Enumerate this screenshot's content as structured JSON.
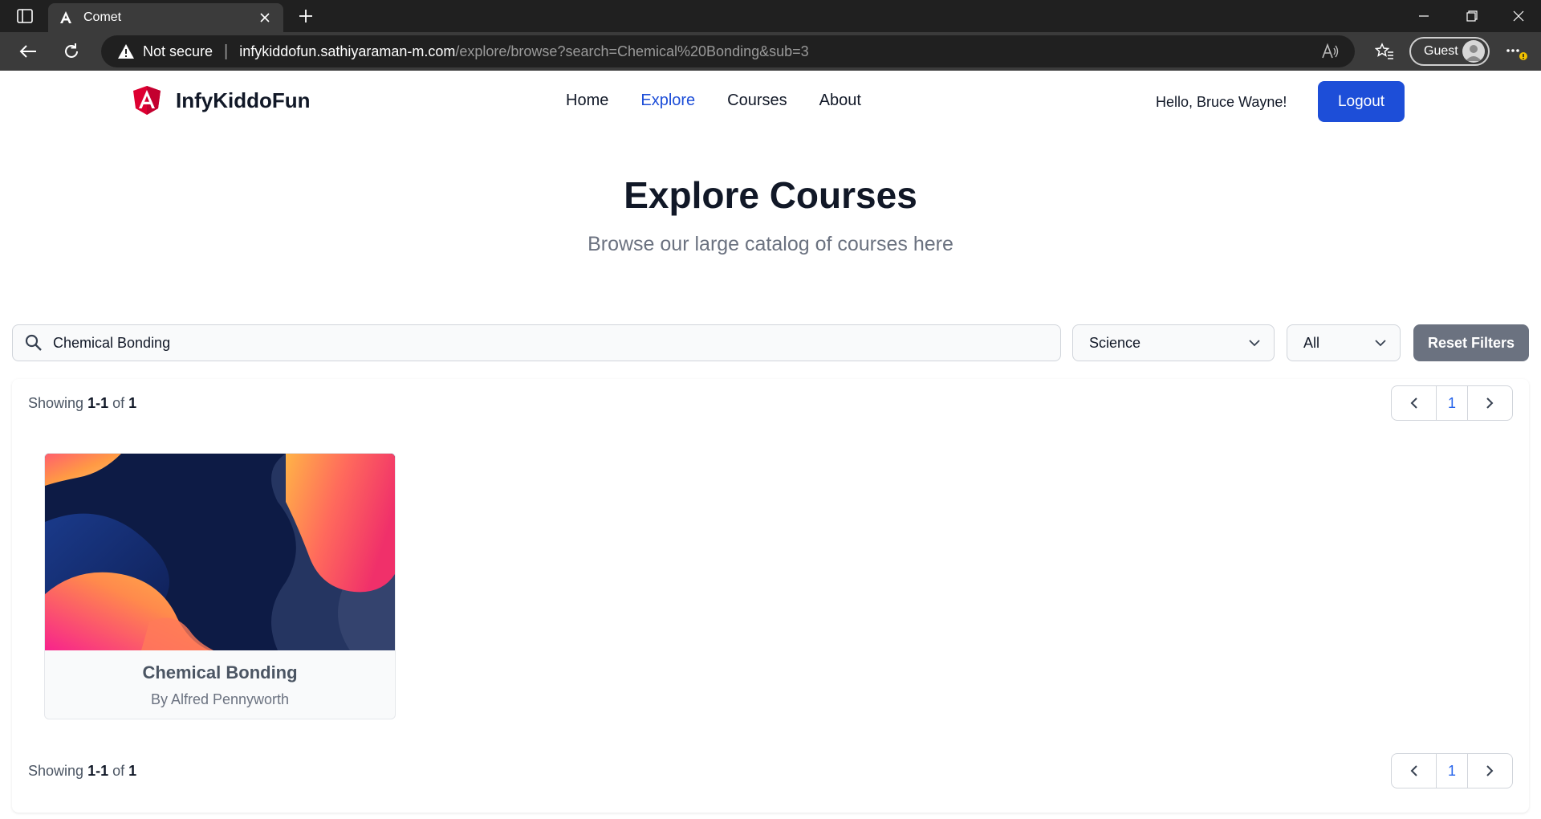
{
  "browser": {
    "tab_title": "Comet",
    "address": {
      "security_label": "Not secure",
      "host": "infykiddofun.sathiyaraman-m.com",
      "path": "/explore/browse?search=Chemical%20Bonding&sub=3"
    },
    "profile_label": "Guest"
  },
  "site": {
    "brand": "InfyKiddoFun",
    "nav": [
      {
        "label": "Home"
      },
      {
        "label": "Explore"
      },
      {
        "label": "Courses"
      },
      {
        "label": "About"
      }
    ],
    "greeting": "Hello, Bruce Wayne!",
    "logout_label": "Logout"
  },
  "hero": {
    "title": "Explore Courses",
    "subtitle": "Browse our large catalog of courses here"
  },
  "filters": {
    "search_value": "Chemical Bonding",
    "subject": "Science",
    "level": "All",
    "reset_label": "Reset Filters"
  },
  "results": {
    "showing_prefix": "Showing",
    "range": "1-1",
    "of_label": "of",
    "total": "1",
    "current_page": "1",
    "courses": [
      {
        "title": "Chemical Bonding",
        "author": "By Alfred Pennyworth"
      }
    ]
  },
  "colors": {
    "primary": "#1d4ed8",
    "reset_button": "#6b7280",
    "chrome_dark": "#202020",
    "chrome_toolbar": "#3b3b3b"
  }
}
